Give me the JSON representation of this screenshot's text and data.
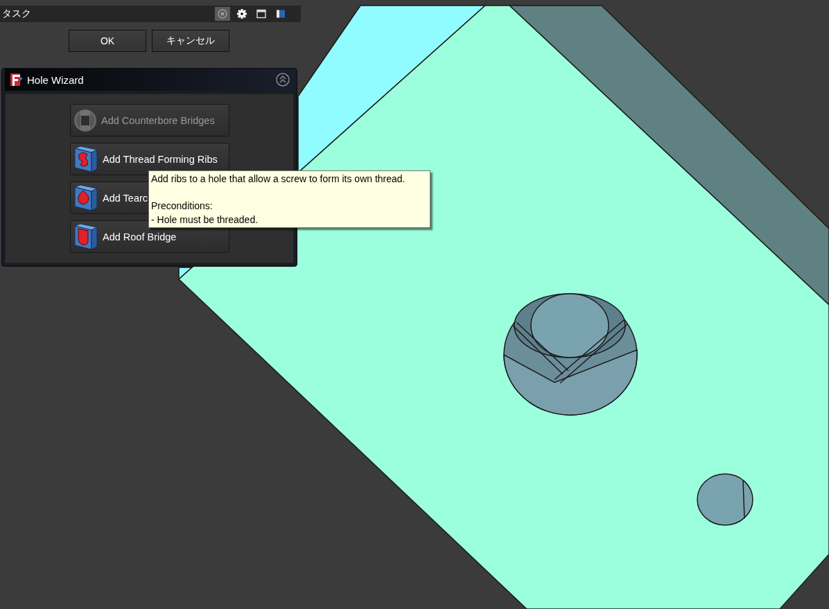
{
  "task_panel": {
    "title": "タスク",
    "toolbar": [
      {
        "selected": true
      },
      {
        "selected": false
      },
      {
        "selected": false
      },
      {
        "selected": false
      }
    ],
    "buttons": [
      "OK",
      "キャンセル"
    ]
  },
  "hole_wizard": {
    "title": "Hole Wizard",
    "buttons": [
      {
        "label": "Add Counterbore Bridges",
        "disabled": true
      },
      {
        "label": "Add Thread Forming Ribs",
        "disabled": false
      },
      {
        "label": "Add Tearc",
        "disabled": false
      },
      {
        "label": "Add Roof Bridge",
        "disabled": false
      }
    ]
  },
  "tooltip": {
    "text": "Add ribs to a hole that allow a screw to form its own thread.\n\nPreconditions:\n- Hole must be threaded."
  }
}
